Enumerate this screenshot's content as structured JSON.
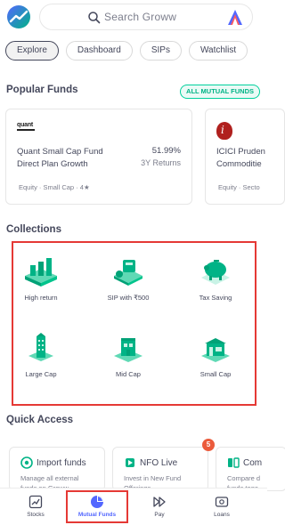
{
  "header": {
    "logo_icon": "groww-logo-icon",
    "search_placeholder": "Search Groww",
    "profile_icon": "profile-avatar-icon"
  },
  "tabs": [
    {
      "label": "Explore",
      "active": true
    },
    {
      "label": "Dashboard",
      "active": false
    },
    {
      "label": "SIPs",
      "active": false
    },
    {
      "label": "Watchlist",
      "active": false
    }
  ],
  "popular_funds": {
    "title": "Popular Funds",
    "all_link": "ALL MUTUAL FUNDS",
    "cards": [
      {
        "logo_text": "quant",
        "name_line1": "Quant Small Cap Fund",
        "name_line2": "Direct Plan Growth",
        "return_value": "51.99%",
        "return_label": "3Y Returns",
        "meta": "Equity · Small Cap · 4★"
      },
      {
        "logo_text": "i",
        "name_line1": "ICICI Pruden",
        "name_line2": "Commoditie",
        "meta": "Equity · Secto"
      }
    ]
  },
  "collections": {
    "title": "Collections",
    "items": [
      {
        "label": "High return",
        "icon": "high-return-icon"
      },
      {
        "label": "SIP with ₹500",
        "icon": "sip-500-icon"
      },
      {
        "label": "Tax Saving",
        "icon": "tax-saving-piggy-icon"
      },
      {
        "label": "Large Cap",
        "icon": "large-cap-building-icon"
      },
      {
        "label": "Mid Cap",
        "icon": "mid-cap-building-icon"
      },
      {
        "label": "Small Cap",
        "icon": "small-cap-shop-icon"
      }
    ]
  },
  "quick_access": {
    "title": "Quick Access",
    "cards": [
      {
        "title": "Import funds",
        "desc_line1": "Manage all external",
        "desc_line2": "funds on Groww"
      },
      {
        "title": "NFO Live",
        "desc_line1": "Invest in New Fund",
        "desc_line2": "Offerings",
        "badge": "5"
      },
      {
        "title": "Com",
        "desc_line1": "Compare d",
        "desc_line2": "funds toge"
      }
    ]
  },
  "bottom_nav": [
    {
      "label": "Stocks",
      "icon": "stocks-chart-icon",
      "active": false
    },
    {
      "label": "Mutual Funds",
      "icon": "mutual-funds-pie-icon",
      "active": true
    },
    {
      "label": "Pay",
      "icon": "pay-forward-icon",
      "active": false
    },
    {
      "label": "Loans",
      "icon": "loans-icon",
      "active": false
    }
  ],
  "colors": {
    "accent_green": "#00b386",
    "active_blue": "#5367ff",
    "highlight_red": "#e53935",
    "text_dark": "#44475b"
  }
}
